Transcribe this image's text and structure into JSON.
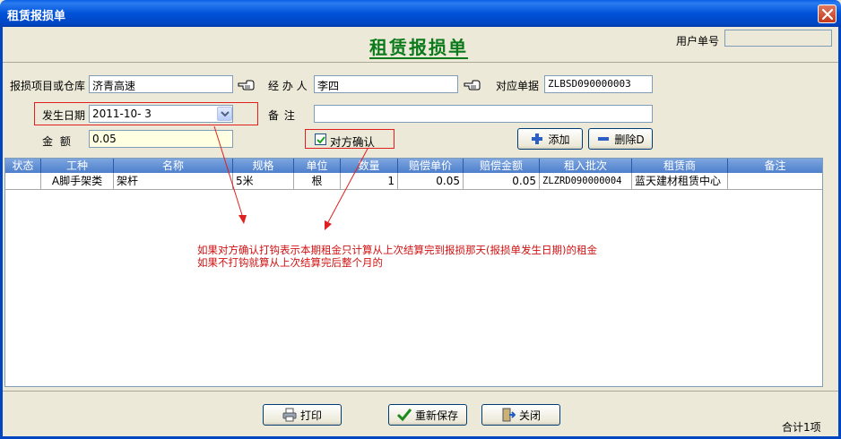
{
  "window": {
    "title": "租赁报损单"
  },
  "header": {
    "form_title": "租赁报损单",
    "user_no_label": "用户单号",
    "user_no_value": ""
  },
  "form": {
    "project_label": "报损项目或仓库",
    "project_value": "济青高速",
    "handler_label": "经 办 人",
    "handler_value": "李四",
    "ref_label": "对应单据",
    "ref_value": "ZLBSD090000003",
    "date_label": "发生日期",
    "date_value": "2011-10- 3",
    "remark_label": "备    注",
    "remark_value": "",
    "amount_label": "金    额",
    "amount_value": "0.05",
    "confirm_label": "对方确认",
    "confirm_checked": true
  },
  "buttons": {
    "add": "添加",
    "delete": "删除D",
    "print": "打印",
    "resave": "重新保存",
    "close": "关闭"
  },
  "table": {
    "columns": [
      "状态",
      "工种",
      "名称",
      "规格",
      "单位",
      "数量",
      "赔偿单价",
      "赔偿金额",
      "租入批次",
      "租赁商",
      "备注"
    ],
    "rows": [
      [
        "",
        "A脚手架类",
        "架杆",
        "5米",
        "根",
        "1",
        "0.05",
        "0.05",
        "ZLZRD090000004",
        "蓝天建材租赁中心",
        ""
      ]
    ]
  },
  "annotation": {
    "line1": "如果对方确认打钩表示本期租金只计算从上次结算完到报损那天(报损单发生日期)的租金",
    "line2": "如果不打钩就算从上次结算完后整个月的"
  },
  "status": {
    "total": "合计1项"
  },
  "colors": {
    "title_green": "#0a7a1a",
    "annotation_red": "#d01010",
    "titlebar_blue": "#0046c2"
  }
}
